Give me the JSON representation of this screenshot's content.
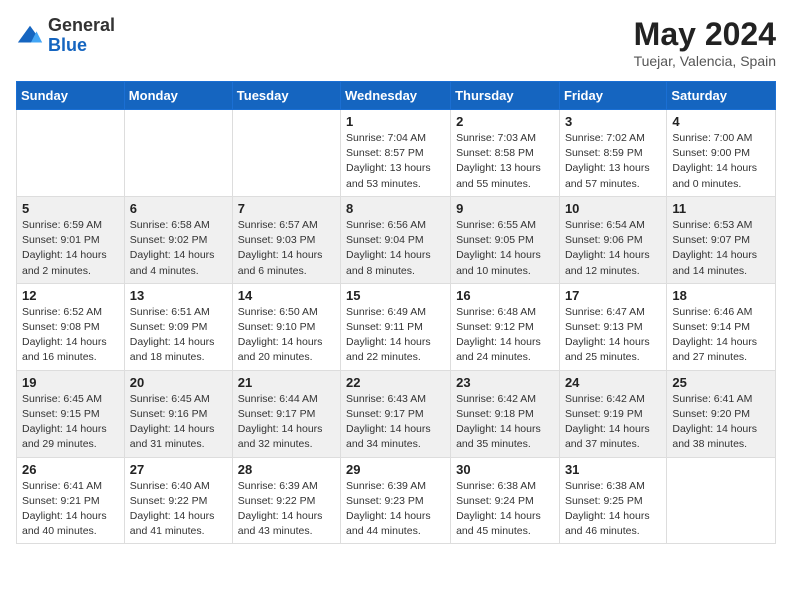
{
  "header": {
    "logo_general": "General",
    "logo_blue": "Blue",
    "month_title": "May 2024",
    "location": "Tuejar, Valencia, Spain"
  },
  "days_of_week": [
    "Sunday",
    "Monday",
    "Tuesday",
    "Wednesday",
    "Thursday",
    "Friday",
    "Saturday"
  ],
  "weeks": [
    [
      {
        "day": "",
        "content": ""
      },
      {
        "day": "",
        "content": ""
      },
      {
        "day": "",
        "content": ""
      },
      {
        "day": "1",
        "content": "Sunrise: 7:04 AM\nSunset: 8:57 PM\nDaylight: 13 hours\nand 53 minutes."
      },
      {
        "day": "2",
        "content": "Sunrise: 7:03 AM\nSunset: 8:58 PM\nDaylight: 13 hours\nand 55 minutes."
      },
      {
        "day": "3",
        "content": "Sunrise: 7:02 AM\nSunset: 8:59 PM\nDaylight: 13 hours\nand 57 minutes."
      },
      {
        "day": "4",
        "content": "Sunrise: 7:00 AM\nSunset: 9:00 PM\nDaylight: 14 hours\nand 0 minutes."
      }
    ],
    [
      {
        "day": "5",
        "content": "Sunrise: 6:59 AM\nSunset: 9:01 PM\nDaylight: 14 hours\nand 2 minutes."
      },
      {
        "day": "6",
        "content": "Sunrise: 6:58 AM\nSunset: 9:02 PM\nDaylight: 14 hours\nand 4 minutes."
      },
      {
        "day": "7",
        "content": "Sunrise: 6:57 AM\nSunset: 9:03 PM\nDaylight: 14 hours\nand 6 minutes."
      },
      {
        "day": "8",
        "content": "Sunrise: 6:56 AM\nSunset: 9:04 PM\nDaylight: 14 hours\nand 8 minutes."
      },
      {
        "day": "9",
        "content": "Sunrise: 6:55 AM\nSunset: 9:05 PM\nDaylight: 14 hours\nand 10 minutes."
      },
      {
        "day": "10",
        "content": "Sunrise: 6:54 AM\nSunset: 9:06 PM\nDaylight: 14 hours\nand 12 minutes."
      },
      {
        "day": "11",
        "content": "Sunrise: 6:53 AM\nSunset: 9:07 PM\nDaylight: 14 hours\nand 14 minutes."
      }
    ],
    [
      {
        "day": "12",
        "content": "Sunrise: 6:52 AM\nSunset: 9:08 PM\nDaylight: 14 hours\nand 16 minutes."
      },
      {
        "day": "13",
        "content": "Sunrise: 6:51 AM\nSunset: 9:09 PM\nDaylight: 14 hours\nand 18 minutes."
      },
      {
        "day": "14",
        "content": "Sunrise: 6:50 AM\nSunset: 9:10 PM\nDaylight: 14 hours\nand 20 minutes."
      },
      {
        "day": "15",
        "content": "Sunrise: 6:49 AM\nSunset: 9:11 PM\nDaylight: 14 hours\nand 22 minutes."
      },
      {
        "day": "16",
        "content": "Sunrise: 6:48 AM\nSunset: 9:12 PM\nDaylight: 14 hours\nand 24 minutes."
      },
      {
        "day": "17",
        "content": "Sunrise: 6:47 AM\nSunset: 9:13 PM\nDaylight: 14 hours\nand 25 minutes."
      },
      {
        "day": "18",
        "content": "Sunrise: 6:46 AM\nSunset: 9:14 PM\nDaylight: 14 hours\nand 27 minutes."
      }
    ],
    [
      {
        "day": "19",
        "content": "Sunrise: 6:45 AM\nSunset: 9:15 PM\nDaylight: 14 hours\nand 29 minutes."
      },
      {
        "day": "20",
        "content": "Sunrise: 6:45 AM\nSunset: 9:16 PM\nDaylight: 14 hours\nand 31 minutes."
      },
      {
        "day": "21",
        "content": "Sunrise: 6:44 AM\nSunset: 9:17 PM\nDaylight: 14 hours\nand 32 minutes."
      },
      {
        "day": "22",
        "content": "Sunrise: 6:43 AM\nSunset: 9:17 PM\nDaylight: 14 hours\nand 34 minutes."
      },
      {
        "day": "23",
        "content": "Sunrise: 6:42 AM\nSunset: 9:18 PM\nDaylight: 14 hours\nand 35 minutes."
      },
      {
        "day": "24",
        "content": "Sunrise: 6:42 AM\nSunset: 9:19 PM\nDaylight: 14 hours\nand 37 minutes."
      },
      {
        "day": "25",
        "content": "Sunrise: 6:41 AM\nSunset: 9:20 PM\nDaylight: 14 hours\nand 38 minutes."
      }
    ],
    [
      {
        "day": "26",
        "content": "Sunrise: 6:41 AM\nSunset: 9:21 PM\nDaylight: 14 hours\nand 40 minutes."
      },
      {
        "day": "27",
        "content": "Sunrise: 6:40 AM\nSunset: 9:22 PM\nDaylight: 14 hours\nand 41 minutes."
      },
      {
        "day": "28",
        "content": "Sunrise: 6:39 AM\nSunset: 9:22 PM\nDaylight: 14 hours\nand 43 minutes."
      },
      {
        "day": "29",
        "content": "Sunrise: 6:39 AM\nSunset: 9:23 PM\nDaylight: 14 hours\nand 44 minutes."
      },
      {
        "day": "30",
        "content": "Sunrise: 6:38 AM\nSunset: 9:24 PM\nDaylight: 14 hours\nand 45 minutes."
      },
      {
        "day": "31",
        "content": "Sunrise: 6:38 AM\nSunset: 9:25 PM\nDaylight: 14 hours\nand 46 minutes."
      },
      {
        "day": "",
        "content": ""
      }
    ]
  ]
}
